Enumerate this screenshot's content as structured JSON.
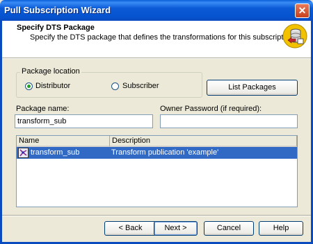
{
  "window": {
    "title": "Pull Subscription Wizard",
    "close_glyph": "✕"
  },
  "header": {
    "title": "Specify DTS Package",
    "subtitle": "Specify the DTS package that defines the transformations for this subscription(s).",
    "icon": "wizard-database-icon"
  },
  "package_location": {
    "legend": "Package location",
    "options": [
      {
        "label": "Distributor",
        "selected": true
      },
      {
        "label": "Subscriber",
        "selected": false
      }
    ]
  },
  "list_packages_button": "List Packages",
  "package_name": {
    "label": "Package name:",
    "value": "transform_sub"
  },
  "owner_password": {
    "label": "Owner Password (if required):",
    "value": ""
  },
  "packages_table": {
    "columns": [
      "Name",
      "Description"
    ],
    "rows": [
      {
        "icon": "dts-package-icon",
        "name": "transform_sub",
        "description": "Transform publication 'example'",
        "selected": true
      }
    ]
  },
  "footer": {
    "back": "< Back",
    "next": "Next >",
    "cancel": "Cancel",
    "help": "Help"
  },
  "colors": {
    "selection": "#316ac5",
    "titlebar": "#0a5fd8",
    "dialog": "#ece9d8"
  }
}
